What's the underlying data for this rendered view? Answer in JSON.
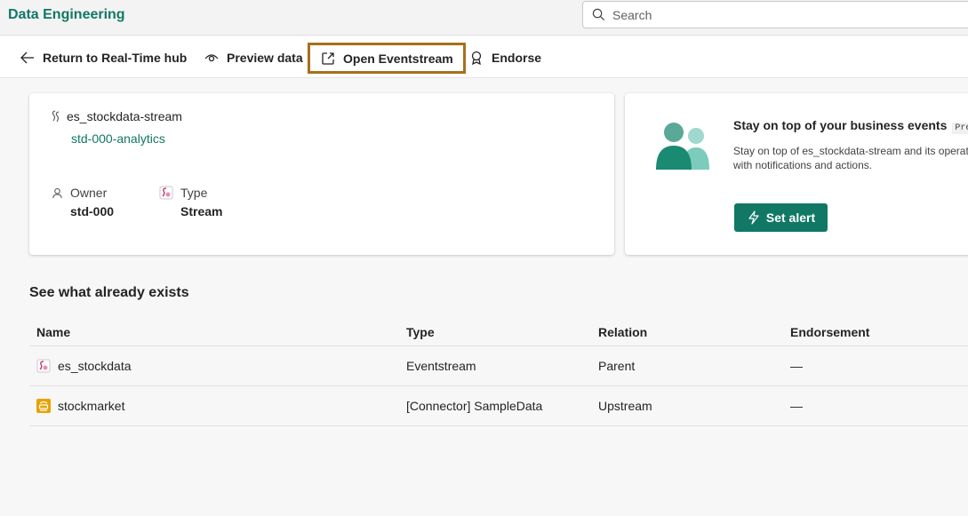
{
  "header": {
    "app_title": "Data Engineering",
    "search_placeholder": "Search"
  },
  "toolbar": {
    "return_label": "Return to Real-Time hub",
    "preview_label": "Preview data",
    "open_label": "Open Eventstream",
    "endorse_label": "Endorse"
  },
  "details": {
    "stream_name": "es_stockdata-stream",
    "workspace": "std-000-analytics",
    "owner_label": "Owner",
    "owner_value": "std-000",
    "type_label": "Type",
    "type_value": "Stream"
  },
  "alert_card": {
    "title": "Stay on top of your business events",
    "badge": "Preview",
    "description": "Stay on top of es_stockdata-stream and its operations with notifications and actions.",
    "button_label": "Set alert"
  },
  "section": {
    "title": "See what already exists"
  },
  "table": {
    "headers": [
      "Name",
      "Type",
      "Relation",
      "Endorsement"
    ],
    "rows": [
      {
        "name": "es_stockdata",
        "type": "Eventstream",
        "relation": "Parent",
        "endorsement": "—",
        "icon": "eventstream-icon"
      },
      {
        "name": "stockmarket",
        "type": "[Connector] SampleData",
        "relation": "Upstream",
        "endorsement": "—",
        "icon": "connector-icon"
      }
    ]
  },
  "colors": {
    "brand": "#117865",
    "highlight": "#a86f1c",
    "eventstream_pink": "#c03a7c",
    "connector_orange": "#e8a200"
  }
}
